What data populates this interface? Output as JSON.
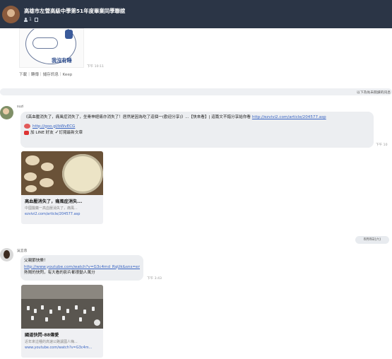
{
  "header": {
    "title": "高雄市左營高級中學第51年度畢業同學聯誼",
    "members_count": "1"
  },
  "sticker": {
    "caption": "我沒有睡",
    "time": "下午 10:11",
    "actions": "下載｜轉傳｜儲存訊息｜Keep"
  },
  "unread_divider": "以下為尚未閱讀的訊息",
  "message1": {
    "sender": "suzi",
    "line1": "《高血壓消失了，痛風症消失了，坐骨神經痛亦消失了！居然是因為吃了這個一(歡迎分享)》...【快來看】| 這篇文不錯分享給你看 ",
    "line1_link": "http://ezvivi2.com/article/204577.asp",
    "line2_link": "http://goo.gl/bWvECG",
    "line3": "加 LINE 好友 ",
    "line3_b": "訂閱最新文章",
    "time": "下午 10"
  },
  "card1": {
    "title": "高血壓消失了，痛風症消失...",
    "desc": "中國醫藥一高血壓消失了，痛風...",
    "url": "ezvivi2.com/article/204577.asp"
  },
  "date_pill": "8月8日(六)",
  "message2": {
    "sender": "吳宜蓉",
    "line1": "父親節快樂！",
    "line2_link": "http://www.youtube.com/watch?v=G3c4md_RqUk&sns=em",
    "line3": "熱鬧的快閃，有大看的影片都很動人萬分",
    "time": "下午 3:43"
  },
  "card2": {
    "title": "國道快閃-88傳愛",
    "desc": "近年來這種的高速公路讓國人嗨...",
    "url": "www.youtube.com/watch?v=G3c4m..."
  }
}
